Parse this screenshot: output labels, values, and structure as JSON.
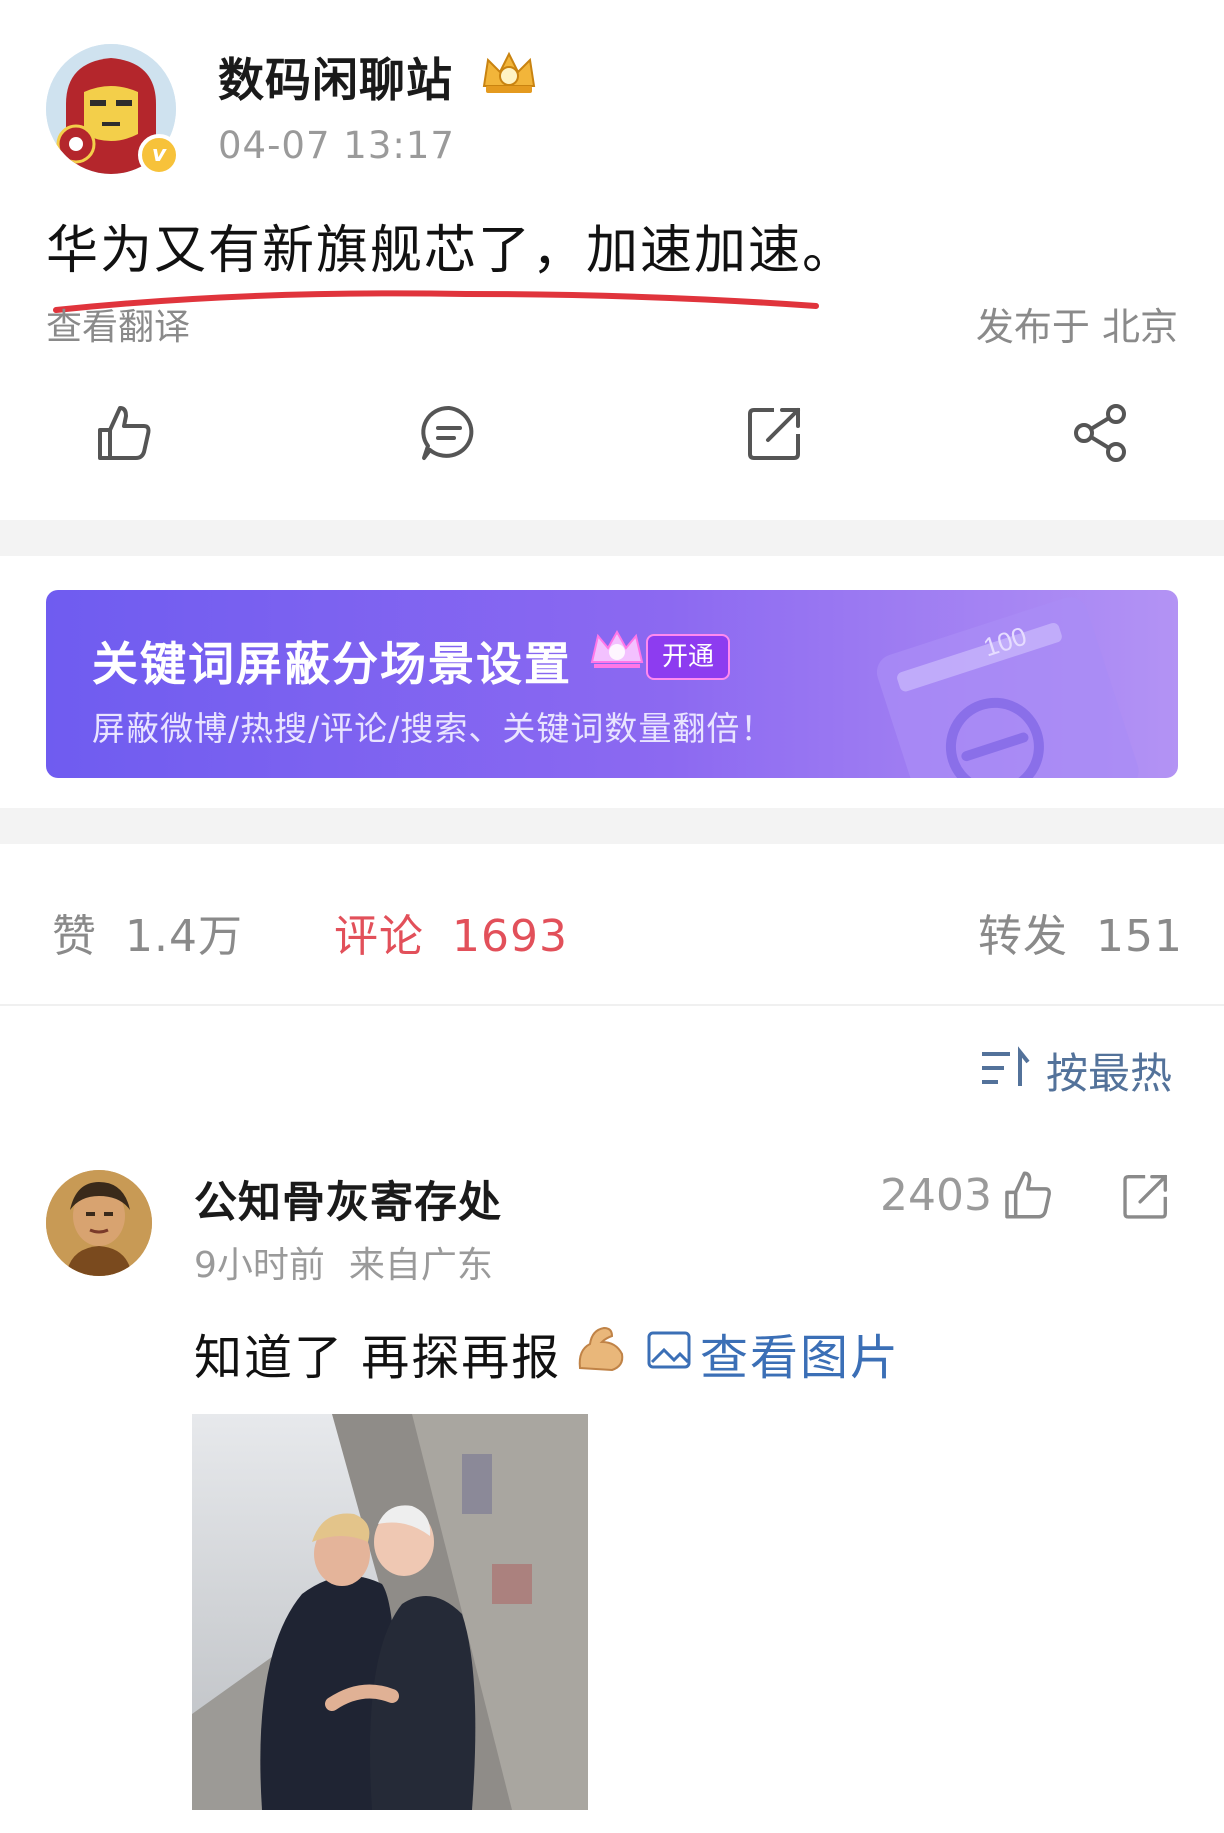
{
  "post": {
    "author": "数码闲聊站",
    "time": "04-07 13:17",
    "text": "华为又有新旗舰芯了，加速加速。",
    "translate": "查看翻译",
    "location": "发布于 北京",
    "verified_badge": "v",
    "icons": [
      "like-icon",
      "comment-icon",
      "repost-icon",
      "share-icon"
    ]
  },
  "promo": {
    "title": "关键词屏蔽分场景设置",
    "button": "开通",
    "subtitle": "屏蔽微博/热搜/评论/搜索、关键词数量翻倍！",
    "card_number": "100"
  },
  "stats": {
    "likes_label": "赞",
    "likes_value": "1.4万",
    "comments_label": "评论",
    "comments_value": "1693",
    "reposts_label": "转发",
    "reposts_value": "151"
  },
  "sort": {
    "label": "按最热"
  },
  "comment": {
    "author": "公知骨灰寄存处",
    "time": "9小时前",
    "from": "来自广东",
    "likes": "2403",
    "text": "知道了 再探再报",
    "view_image": "查看图片"
  },
  "colors": {
    "accent_red": "#e2505a",
    "link_blue": "#3b6fb6",
    "promo_purple": "#7a63f0",
    "muted_gray": "#9a9a9a"
  }
}
